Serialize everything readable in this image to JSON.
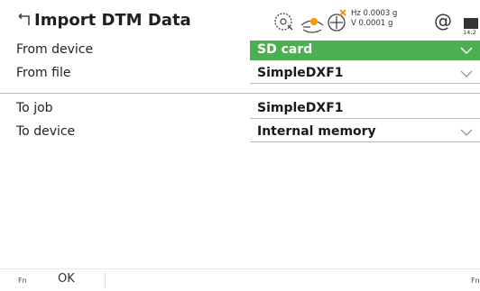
{
  "title": "Import DTM Data",
  "status": {
    "hz": "Hz 0.0003 g",
    "v": "V  0.0001 g",
    "at": "@",
    "time": "14:2"
  },
  "rows": [
    {
      "label": "From device",
      "value": "SD card"
    },
    {
      "label": "From file",
      "value": "SimpleDXF1"
    },
    {
      "label": "To job",
      "value": "SimpleDXF1"
    },
    {
      "label": "To device",
      "value": "Internal memory"
    }
  ],
  "softkeys": {
    "fn_left": "Fn",
    "ok": "OK",
    "fn_right": "Fn"
  },
  "colors": {
    "accent": "#4caf50"
  }
}
